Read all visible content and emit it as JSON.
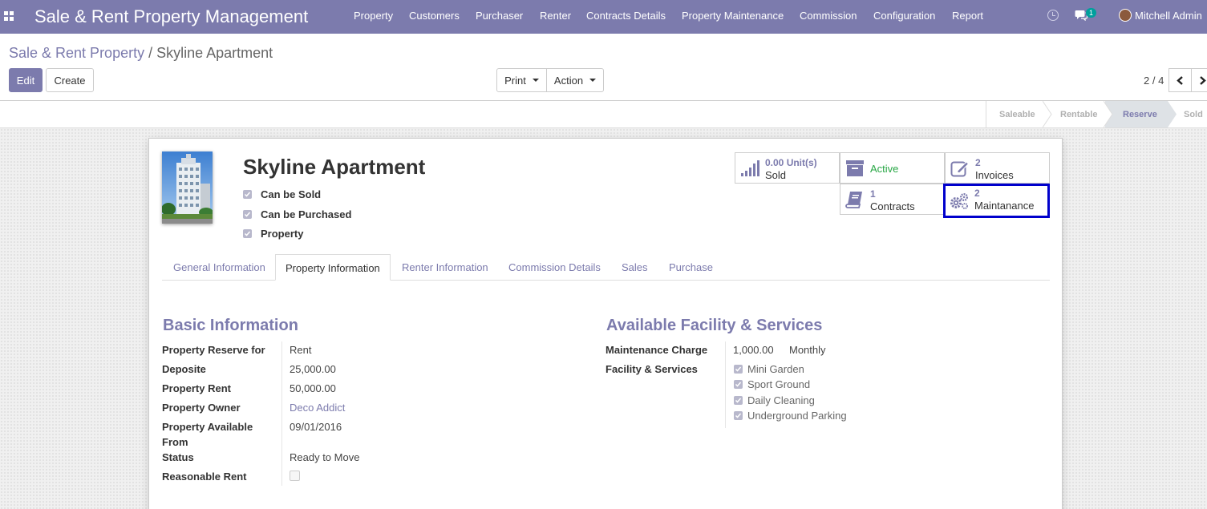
{
  "navbar": {
    "brand": "Sale & Rent Property Management",
    "menu": [
      "Property",
      "Customers",
      "Purchaser",
      "Renter",
      "Contracts Details",
      "Property Maintenance",
      "Commission",
      "Configuration",
      "Report"
    ],
    "chat_badge": "1",
    "user": "Mitchell Admin"
  },
  "breadcrumb": {
    "parent": "Sale & Rent Property",
    "separator": "/",
    "current": "Skyline Apartment"
  },
  "actions": {
    "edit": "Edit",
    "create": "Create",
    "print": "Print",
    "action": "Action"
  },
  "pager": {
    "value": "2 / 4"
  },
  "statusbar": {
    "stages": [
      "Saleable",
      "Rentable",
      "Reserve",
      "Sold"
    ],
    "current": "Reserve"
  },
  "record": {
    "name": "Skyline Apartment",
    "flags": [
      {
        "label": "Can be Sold",
        "checked": true
      },
      {
        "label": "Can be Purchased",
        "checked": true
      },
      {
        "label": "Property",
        "checked": true
      }
    ]
  },
  "smart_buttons": {
    "sold": {
      "value": "0.00 Unit(s)",
      "label": "Sold",
      "icon": "signal-bars-icon"
    },
    "active": {
      "label": "Active",
      "icon": "archive-icon"
    },
    "invoices": {
      "value": "2",
      "label": "Invoices",
      "icon": "edit-icon"
    },
    "contracts": {
      "value": "1",
      "label": "Contracts",
      "icon": "book-icon"
    },
    "maintenance": {
      "value": "2",
      "label": "Maintanance",
      "icon": "gears-icon"
    }
  },
  "tabs": [
    "General Information",
    "Property Information",
    "Renter Information",
    "Commission Details",
    "Sales",
    "Purchase"
  ],
  "basic_info": {
    "title": "Basic Information",
    "fields": {
      "reserve_for": {
        "label": "Property Reserve for",
        "value": "Rent"
      },
      "deposite": {
        "label": "Deposite",
        "value": "25,000.00"
      },
      "rent": {
        "label": "Property Rent",
        "value": "50,000.00"
      },
      "owner": {
        "label": "Property Owner",
        "value": "Deco Addict"
      },
      "available_from": {
        "label": "Property Available From",
        "value": "09/01/2016"
      },
      "status": {
        "label": "Status",
        "value": "Ready to Move"
      },
      "reasonable_rent": {
        "label": "Reasonable Rent",
        "checked": false
      }
    }
  },
  "facilities": {
    "title": "Available Facility & Services",
    "maintenance_charge": {
      "label": "Maintenance Charge",
      "value": "1,000.00",
      "period": "Monthly"
    },
    "facility_label": "Facility & Services",
    "items": [
      "Mini Garden",
      "Sport Ground",
      "Daily Cleaning",
      "Underground Parking"
    ]
  },
  "colors": {
    "brand": "#7c7bad",
    "highlight": "#0000cc",
    "active_green": "#28a745"
  }
}
